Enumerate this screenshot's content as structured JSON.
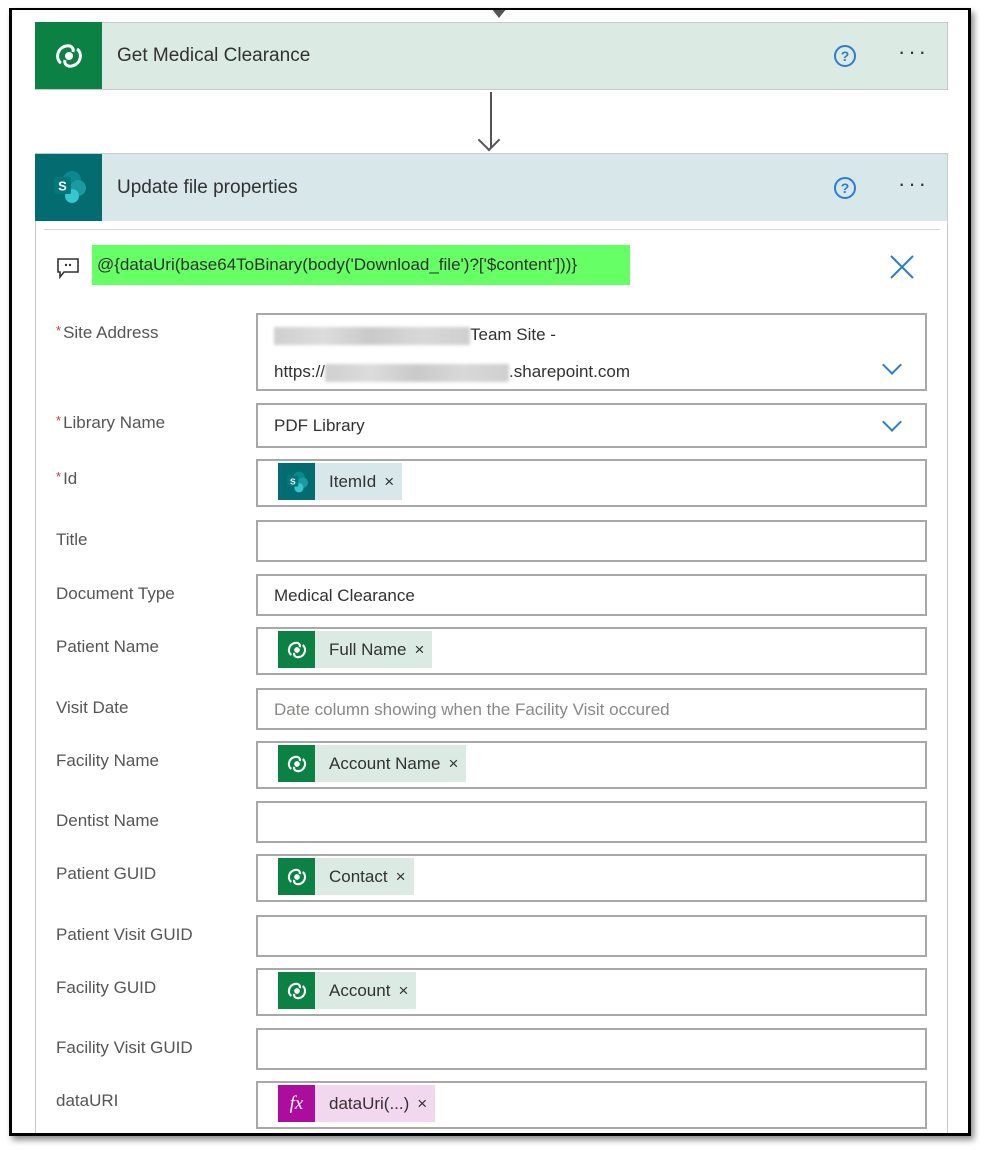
{
  "flow": {
    "step1": {
      "title": "Get Medical Clearance",
      "icon": "dataverse-icon",
      "help_label": "?",
      "more_label": "···"
    },
    "step2": {
      "title": "Update file properties",
      "icon": "sharepoint-icon",
      "help_label": "?",
      "more_label": "···",
      "comment": "@{dataUri(base64ToBinary(body('Download_file')?['$content']))}",
      "comment_highlight_color": "#66ff66",
      "fields": {
        "site_address": {
          "label": "Site Address",
          "required": "*",
          "line1_suffix": "Team Site -",
          "line2_prefix": "https://",
          "line2_suffix": ".sharepoint.com"
        },
        "library_name": {
          "label": "Library Name",
          "required": "*",
          "value": "PDF Library"
        },
        "id": {
          "label": "Id",
          "required": "*",
          "token": "ItemId",
          "token_type": "sharepoint"
        },
        "title": {
          "label": "Title",
          "value": ""
        },
        "document_type": {
          "label": "Document Type",
          "value": "Medical Clearance"
        },
        "patient_name": {
          "label": "Patient Name",
          "token": "Full Name",
          "token_type": "dataverse"
        },
        "visit_date": {
          "label": "Visit Date",
          "placeholder": "Date column showing when the Facility Visit occured"
        },
        "facility_name": {
          "label": "Facility Name",
          "token": "Account Name",
          "token_type": "dataverse"
        },
        "dentist_name": {
          "label": "Dentist Name",
          "value": ""
        },
        "patient_guid": {
          "label": "Patient GUID",
          "token": "Contact",
          "token_type": "dataverse"
        },
        "patient_visit_guid": {
          "label": "Patient Visit GUID",
          "value": ""
        },
        "facility_guid": {
          "label": "Facility GUID",
          "token": "Account",
          "token_type": "dataverse"
        },
        "facility_visit_guid": {
          "label": "Facility Visit GUID",
          "value": ""
        },
        "data_uri": {
          "label": "dataURI",
          "token": "dataUri(...)",
          "token_type": "expression",
          "token_icon_label": "fx"
        }
      },
      "token_remove_label": "×"
    }
  },
  "colors": {
    "dataverse": "#0b8143",
    "sharepoint": "#036c70",
    "expression": "#ad0d9f",
    "accent": "#2b7cd3",
    "required": "#d13438"
  }
}
